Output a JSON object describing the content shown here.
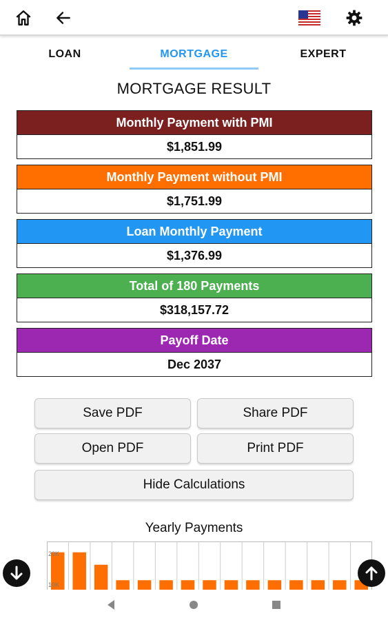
{
  "tabs": [
    "LOAN",
    "MORTGAGE",
    "EXPERT"
  ],
  "title": "MORTGAGE RESULT",
  "results": [
    {
      "label": "Monthly Payment with PMI",
      "value": "$1,851.99",
      "color": "#7b1f1f"
    },
    {
      "label": "Monthly Payment without PMI",
      "value": "$1,751.99",
      "color": "#ff6f00"
    },
    {
      "label": "Loan Monthly Payment",
      "value": "$1,376.99",
      "color": "#2196f3"
    },
    {
      "label": "Total of 180 Payments",
      "value": "$318,157.72",
      "color": "#4caf50"
    },
    {
      "label": "Payoff Date",
      "value": "Dec 2037",
      "color": "#9c27b0"
    }
  ],
  "buttons": {
    "save_pdf": "Save PDF",
    "share_pdf": "Share PDF",
    "open_pdf": "Open PDF",
    "print_pdf": "Print PDF",
    "hide_calculations": "Hide Calculations"
  },
  "icons": {
    "home": "home-icon",
    "back": "arrow-left-icon",
    "flag": "us-flag-icon",
    "settings": "gear-icon",
    "scroll_down": "arrow-down-icon",
    "scroll_up": "arrow-up-icon"
  },
  "chart_data": {
    "type": "bar",
    "title": "Yearly Payments",
    "y_tick_labels": [
      "20K",
      "10K"
    ],
    "bar_color": "#ff6f00",
    "values": [
      20500,
      20500,
      16500,
      11500,
      11500,
      11500,
      11500,
      11500,
      11500,
      11500,
      11500,
      11500,
      11500,
      11500,
      11500
    ],
    "ylim": [
      8000,
      24000
    ]
  }
}
